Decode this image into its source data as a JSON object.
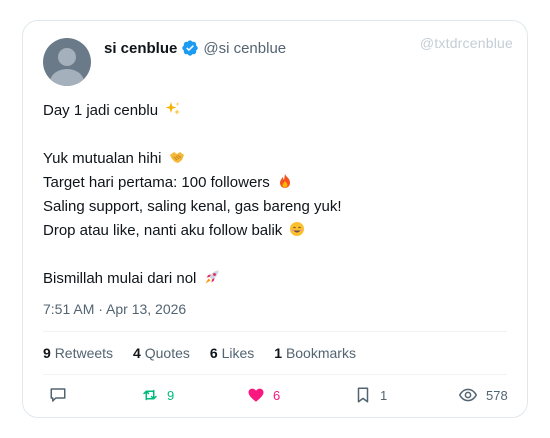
{
  "watermark": "@txtdrcenblue",
  "author": {
    "display_name": "si cenblue",
    "handle": "@si cenblue",
    "verified": true,
    "avatar_icon": "default-avatar-icon"
  },
  "tweet": {
    "lines": [
      {
        "text": "Day 1 jadi cenblu",
        "emoji": "sparkles-emoji"
      },
      {
        "text": "",
        "emoji": ""
      },
      {
        "text": "Yuk mutualan hihi",
        "emoji": "handshake-emoji"
      },
      {
        "text": "Target hari pertama: 100 followers",
        "emoji": "fire-emoji"
      },
      {
        "text": "Saling support, saling kenal, gas bareng yuk!",
        "emoji": ""
      },
      {
        "text": "Drop atau like, nanti aku follow balik",
        "emoji": "smiling-face-emoji"
      },
      {
        "text": "",
        "emoji": ""
      },
      {
        "text": "Bismillah mulai dari nol",
        "emoji": "rocket-emoji"
      }
    ],
    "timestamp": "7:51 AM · Apr 13, 2026"
  },
  "stats": {
    "retweets": {
      "count": "9",
      "label": "Retweets"
    },
    "quotes": {
      "count": "4",
      "label": "Quotes"
    },
    "likes": {
      "count": "6",
      "label": "Likes"
    },
    "bookmarks": {
      "count": "1",
      "label": "Bookmarks"
    }
  },
  "actions": {
    "reply": {
      "icon": "reply-icon",
      "count": ""
    },
    "retweet": {
      "icon": "retweet-icon",
      "count": "9"
    },
    "like": {
      "icon": "heart-icon",
      "count": "6"
    },
    "bookmark": {
      "icon": "bookmark-icon",
      "count": "1"
    },
    "views": {
      "icon": "views-icon",
      "count": "578"
    }
  },
  "colors": {
    "verified": "#1d9bf0",
    "retweet": "#00ba7c",
    "like": "#f91880",
    "muted": "#536471"
  }
}
